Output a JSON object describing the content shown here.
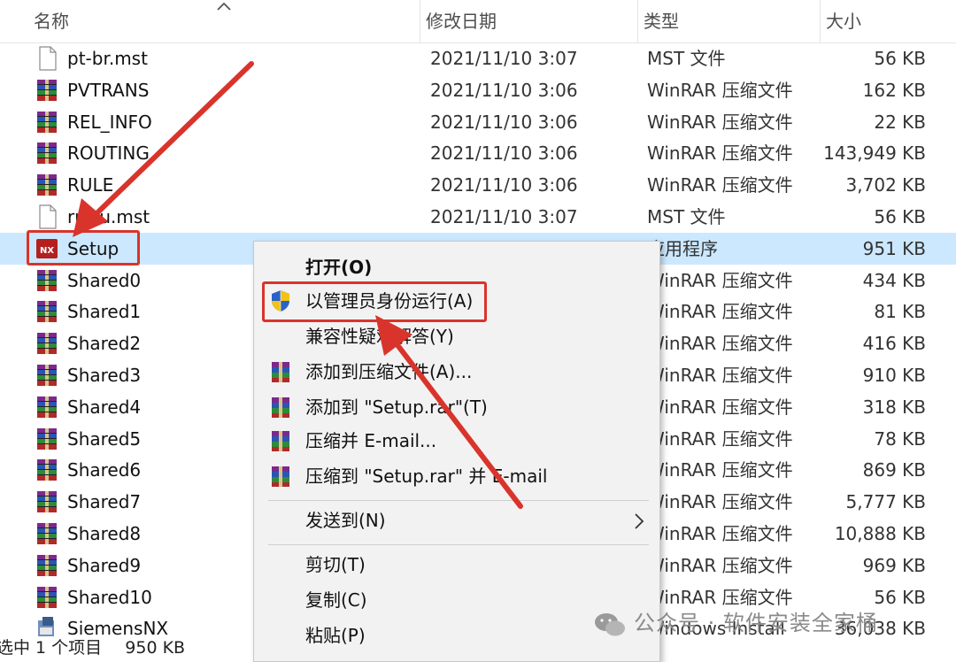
{
  "header": {
    "col_name": "名称",
    "col_date": "修改日期",
    "col_type": "类型",
    "col_size": "大小"
  },
  "files": [
    {
      "name": "pt-br.mst",
      "date": "2021/11/10 3:07",
      "type": "MST 文件",
      "size": "56 KB",
      "icon": "document-icon"
    },
    {
      "name": "PVTRANS",
      "date": "2021/11/10 3:06",
      "type": "WinRAR 压缩文件",
      "size": "162 KB",
      "icon": "winrar-archive-icon"
    },
    {
      "name": "REL_INFO",
      "date": "2021/11/10 3:06",
      "type": "WinRAR 压缩文件",
      "size": "22 KB",
      "icon": "winrar-archive-icon"
    },
    {
      "name": "ROUTING",
      "date": "2021/11/10 3:06",
      "type": "WinRAR 压缩文件",
      "size": "143,949 KB",
      "icon": "winrar-archive-icon"
    },
    {
      "name": "RULE",
      "date": "2021/11/10 3:06",
      "type": "WinRAR 压缩文件",
      "size": "3,702 KB",
      "icon": "winrar-archive-icon"
    },
    {
      "name": "ru-ru.mst",
      "date": "2021/11/10 3:07",
      "type": "MST 文件",
      "size": "56 KB",
      "icon": "document-icon"
    },
    {
      "name": "Setup",
      "date": "",
      "type": "应用程序",
      "size": "951 KB",
      "icon": "nx-app-icon"
    },
    {
      "name": "Shared0",
      "date": "",
      "type": "WinRAR 压缩文件",
      "size": "434 KB",
      "icon": "winrar-archive-icon"
    },
    {
      "name": "Shared1",
      "date": "",
      "type": "WinRAR 压缩文件",
      "size": "81 KB",
      "icon": "winrar-archive-icon"
    },
    {
      "name": "Shared2",
      "date": "",
      "type": "WinRAR 压缩文件",
      "size": "416 KB",
      "icon": "winrar-archive-icon"
    },
    {
      "name": "Shared3",
      "date": "",
      "type": "WinRAR 压缩文件",
      "size": "910 KB",
      "icon": "winrar-archive-icon"
    },
    {
      "name": "Shared4",
      "date": "",
      "type": "WinRAR 压缩文件",
      "size": "318 KB",
      "icon": "winrar-archive-icon"
    },
    {
      "name": "Shared5",
      "date": "",
      "type": "WinRAR 压缩文件",
      "size": "78 KB",
      "icon": "winrar-archive-icon"
    },
    {
      "name": "Shared6",
      "date": "",
      "type": "WinRAR 压缩文件",
      "size": "869 KB",
      "icon": "winrar-archive-icon"
    },
    {
      "name": "Shared7",
      "date": "",
      "type": "WinRAR 压缩文件",
      "size": "5,777 KB",
      "icon": "winrar-archive-icon"
    },
    {
      "name": "Shared8",
      "date": "",
      "type": "WinRAR 压缩文件",
      "size": "10,888 KB",
      "icon": "winrar-archive-icon"
    },
    {
      "name": "Shared9",
      "date": "",
      "type": "WinRAR 压缩文件",
      "size": "969 KB",
      "icon": "winrar-archive-icon"
    },
    {
      "name": "Shared10",
      "date": "",
      "type": "WinRAR 压缩文件",
      "size": "56 KB",
      "icon": "winrar-archive-icon"
    },
    {
      "name": "SiemensNX",
      "date": "",
      "type": "Windows Install",
      "size": "36,038 KB",
      "icon": "installer-icon"
    }
  ],
  "context_menu": {
    "open": "打开(O)",
    "run_as_admin": "以管理员身份运行(A)",
    "compat": "兼容性疑难解答(Y)",
    "add_archive": "添加到压缩文件(A)...",
    "add_setup_rar": "添加到 \"Setup.rar\"(T)",
    "compress_email": "压缩并 E-mail...",
    "compress_setup_email": "压缩到 \"Setup.rar\" 并 E-mail",
    "send_to": "发送到(N)",
    "cut": "剪切(T)",
    "copy": "复制(C)",
    "paste": "粘贴(P)"
  },
  "status": {
    "selected": "选中 1 个项目",
    "size": "950 KB"
  },
  "watermark": "公众号 · 软件安装全家桶",
  "colors": {
    "selection": "#cce8ff",
    "highlight_red": "#d9342b",
    "menu_bg": "#f2f2f2"
  }
}
